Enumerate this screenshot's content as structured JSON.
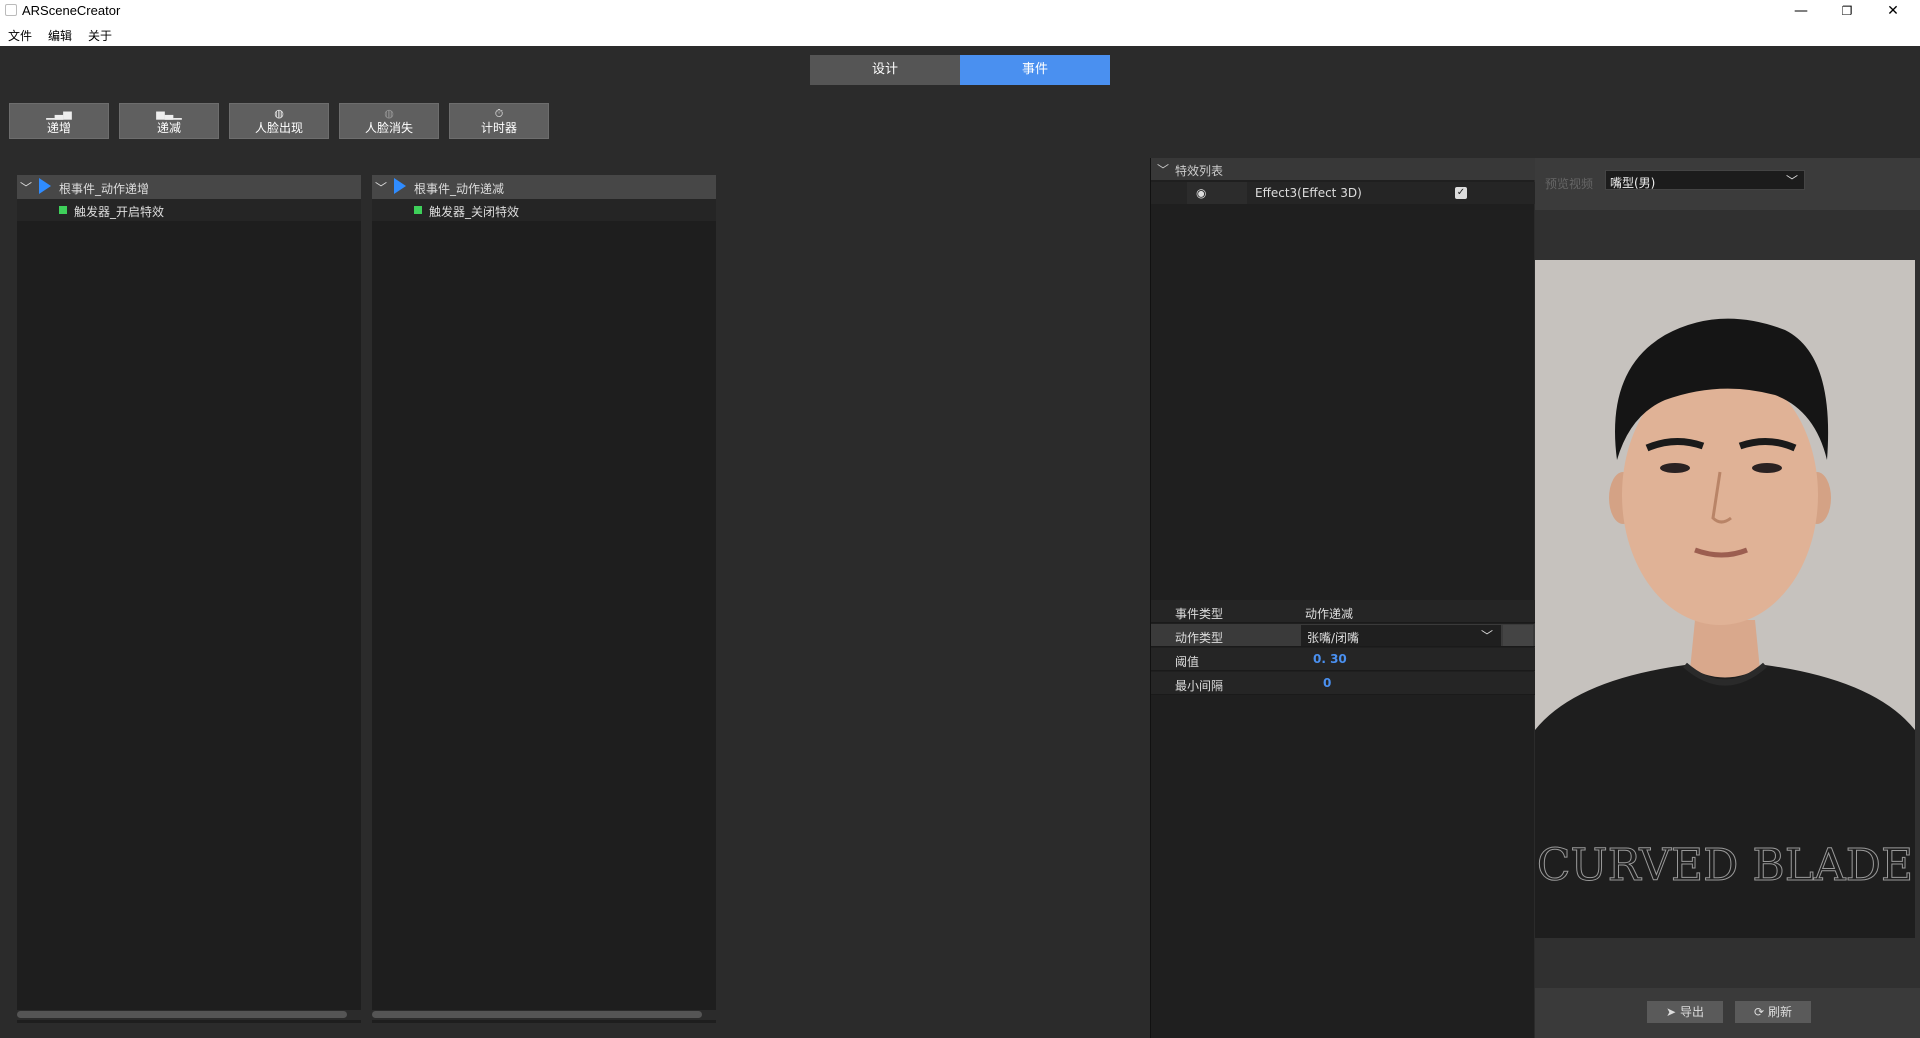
{
  "window": {
    "title": "ARSceneCreator",
    "controls": [
      "—",
      "❐",
      "✕"
    ]
  },
  "menu": [
    "文件",
    "编辑",
    "关于"
  ],
  "tabs": [
    {
      "label": "设计",
      "active": false
    },
    {
      "label": "事件",
      "active": true
    }
  ],
  "toolbar": [
    {
      "label": "递增",
      "icon": "increment-icon"
    },
    {
      "label": "递减",
      "icon": "decrement-icon"
    },
    {
      "label": "人脸出现",
      "icon": "face-appear-icon"
    },
    {
      "label": "人脸消失",
      "icon": "face-disappear-icon"
    },
    {
      "label": "计时器",
      "icon": "timer-icon"
    }
  ],
  "event_trees": [
    {
      "root": "根事件_动作递增",
      "child": "触发器_开启特效"
    },
    {
      "root": "根事件_动作递减",
      "child": "触发器_关闭特效"
    }
  ],
  "effects": {
    "header": "特效列表",
    "items": [
      {
        "name": "Effect3(Effect 3D)",
        "checked": true
      }
    ]
  },
  "properties": {
    "event_type_label": "事件类型",
    "event_type_value": "动作递减",
    "action_type_label": "动作类型",
    "action_type_value": "张嘴/闭嘴",
    "threshold_label": "阈值",
    "threshold_value": "0. 30",
    "min_interval_label": "最小间隔",
    "min_interval_value": "0"
  },
  "preview": {
    "label": "预览视频",
    "selected": "嘴型(男)",
    "export_label": "导出",
    "refresh_label": "刷新",
    "shirt_text": "CURVED BLADE"
  },
  "colors": {
    "accent": "#4a90f0",
    "trigger_green": "#3ed05a",
    "play_blue": "#2f8cff",
    "background": "#2b2b2b"
  }
}
